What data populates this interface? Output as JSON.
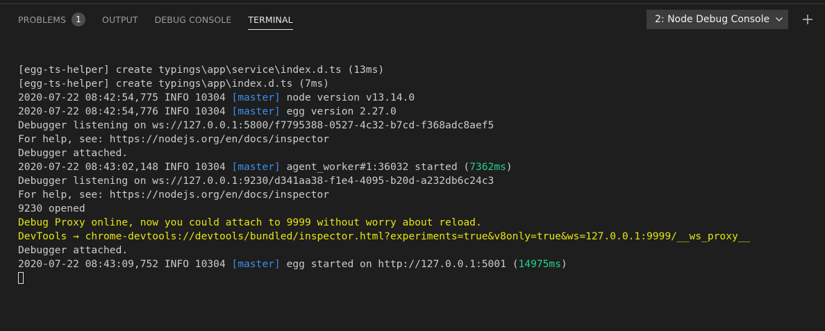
{
  "panel": {
    "tabs": [
      {
        "label": "PROBLEMS",
        "badge": "1"
      },
      {
        "label": "OUTPUT"
      },
      {
        "label": "DEBUG CONSOLE"
      },
      {
        "label": "TERMINAL",
        "active": true
      }
    ],
    "terminal_select": "2: Node Debug Console"
  },
  "colors": {
    "background": "#1e1e1e",
    "text": "#cccccc",
    "tag": "#3b8eea",
    "timing": "#23d18b",
    "warning": "#e5e510"
  },
  "terminal": {
    "lines": [
      {
        "text": "[egg-ts-helper] create typings\\app\\service\\index.d.ts (13ms)"
      },
      {
        "text": "[egg-ts-helper] create typings\\app\\index.d.ts (7ms)"
      },
      {
        "prefix": "2020-07-22 08:42:54,775 INFO 10304 ",
        "tag": "[master]",
        "rest": " node version v13.14.0"
      },
      {
        "prefix": "2020-07-22 08:42:54,776 INFO 10304 ",
        "tag": "[master]",
        "rest": " egg version 2.27.0"
      },
      {
        "text": "Debugger listening on ws://127.0.0.1:5800/f7795388-0527-4c32-b7cd-f368adc8aef5"
      },
      {
        "text": "For help, see: https://nodejs.org/en/docs/inspector"
      },
      {
        "text": "Debugger attached."
      },
      {
        "prefix": "2020-07-22 08:43:02,148 INFO 10304 ",
        "tag": "[master]",
        "rest": " agent_worker#1:36032 started (",
        "timing": "7362ms",
        "suffix": ")"
      },
      {
        "text": "Debugger listening on ws://127.0.0.1:9230/d341aa38-f1e4-4095-b20d-a232db6c24c3"
      },
      {
        "text": "For help, see: https://nodejs.org/en/docs/inspector"
      },
      {
        "text": "9230 opened"
      },
      {
        "warn": "Debug Proxy online, now you could attach to 9999 without worry about reload."
      },
      {
        "warn": "DevTools → chrome-devtools://devtools/bundled/inspector.html?experiments=true&v8only=true&ws=127.0.0.1:9999/__ws_proxy__"
      },
      {
        "text": "Debugger attached."
      },
      {
        "prefix": "2020-07-22 08:43:09,752 INFO 10304 ",
        "tag": "[master]",
        "rest": " egg started on http://127.0.0.1:5001 (",
        "timing": "14975ms",
        "suffix": ")"
      }
    ]
  }
}
